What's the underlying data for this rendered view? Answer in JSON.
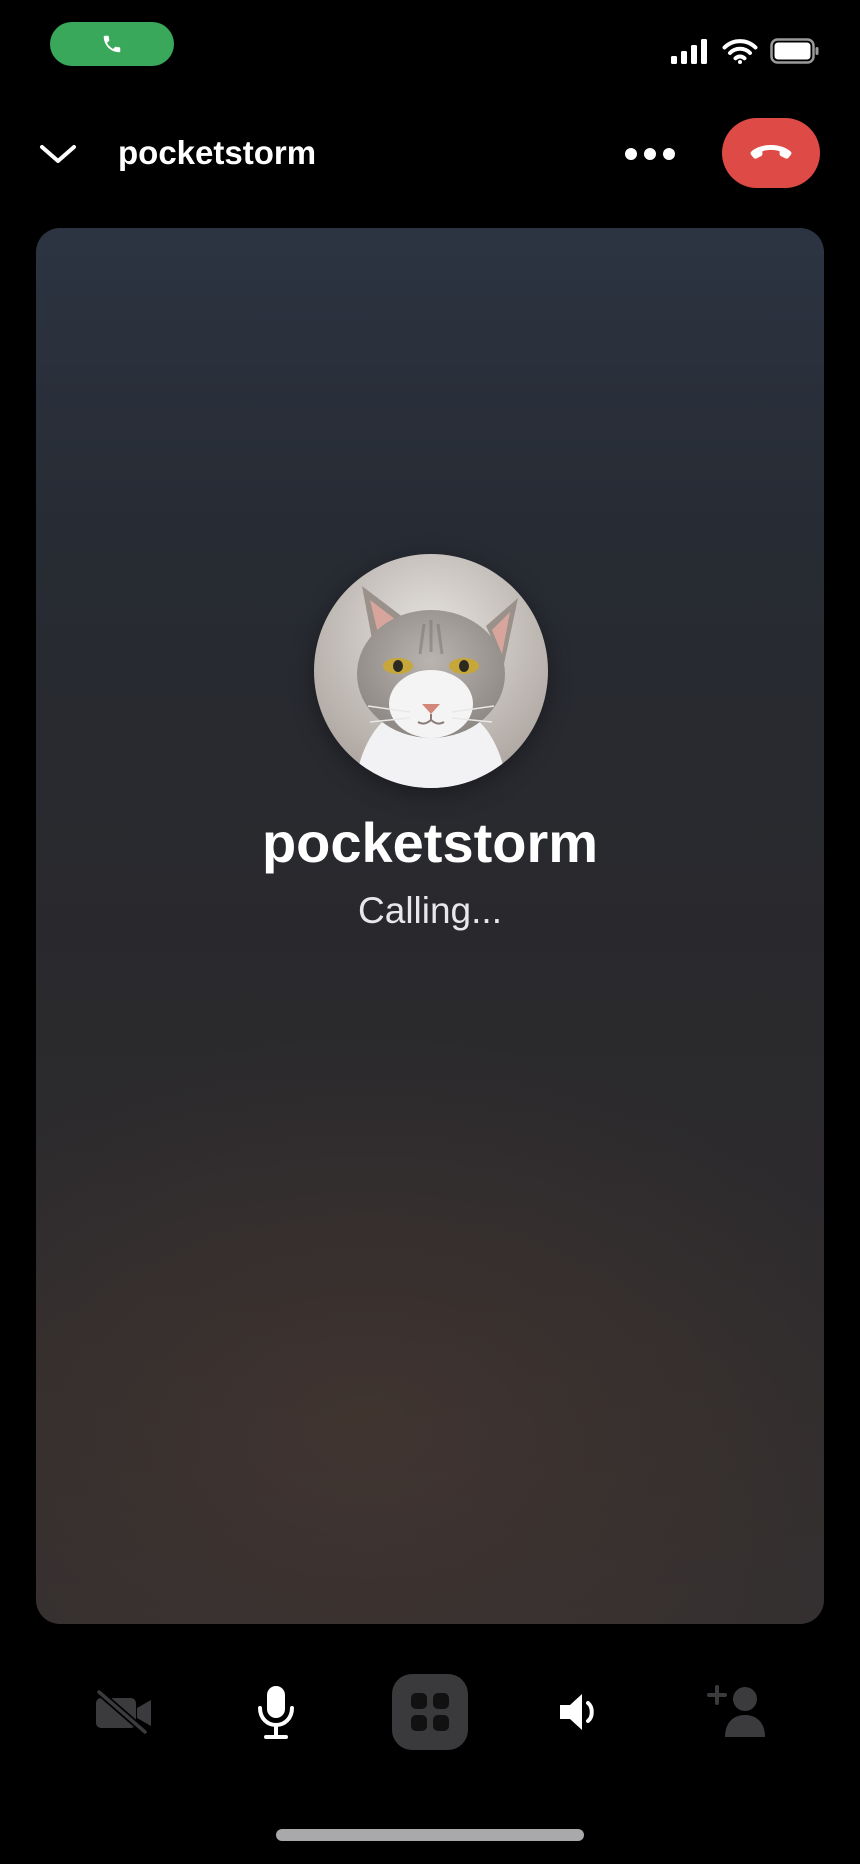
{
  "status_bar": {
    "active_call_icon": "phone-icon",
    "icons": [
      "cellular-signal-icon",
      "wifi-icon",
      "battery-icon"
    ],
    "call_pill_color": "#3aa85a"
  },
  "header": {
    "title": "pocketstorm",
    "collapse_icon": "chevron-down-icon",
    "more_icon": "more-horizontal-icon",
    "end_call_icon": "phone-hangup-icon",
    "end_call_color": "#de4a45"
  },
  "call": {
    "callee_name": "pocketstorm",
    "status": "Calling..."
  },
  "controls": [
    {
      "name": "camera-off-icon",
      "state": "disabled"
    },
    {
      "name": "microphone-icon",
      "state": "on"
    },
    {
      "name": "grid-icon",
      "state": "selected"
    },
    {
      "name": "speaker-icon",
      "state": "on"
    },
    {
      "name": "add-participant-icon",
      "state": "disabled"
    }
  ]
}
